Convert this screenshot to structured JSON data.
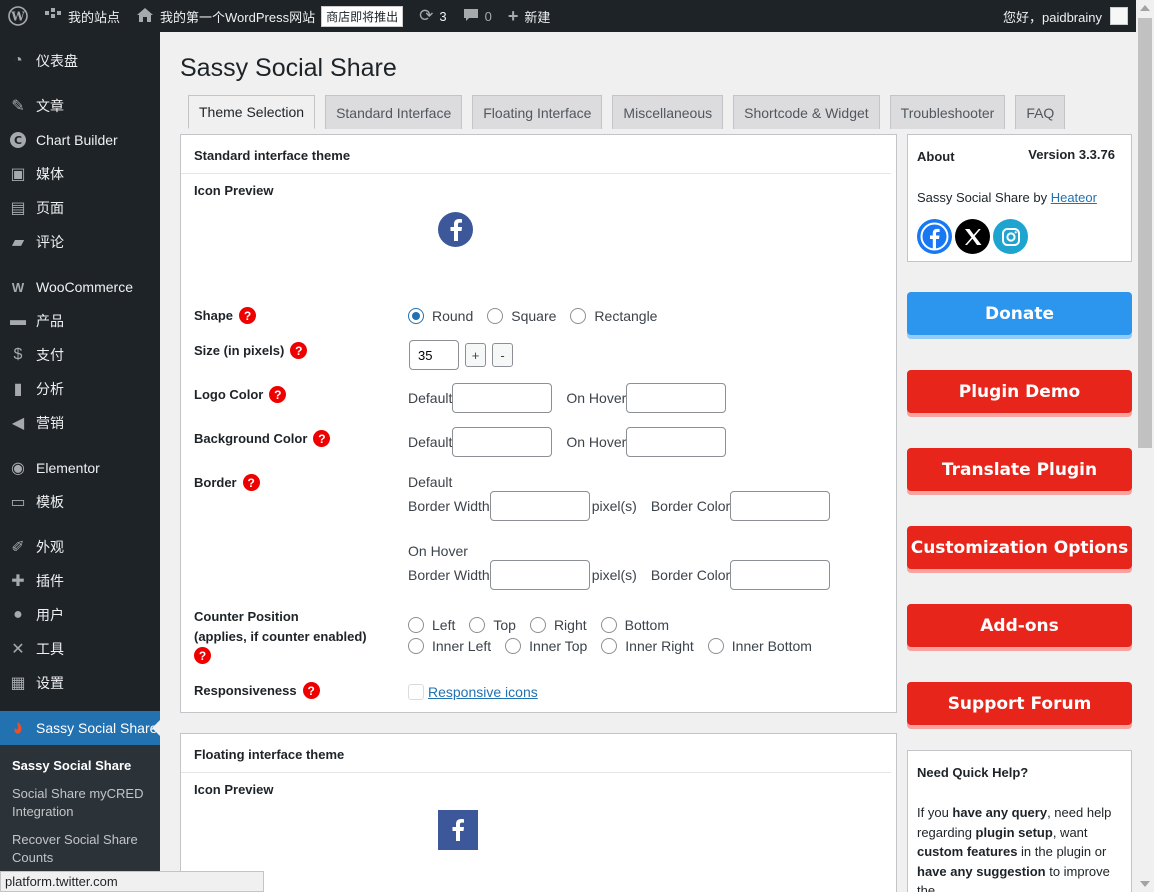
{
  "adminbar": {
    "site_name": "我的站点",
    "site_title": "我的第一个WordPress网站",
    "shop_badge": "商店即将推出",
    "updates_count": "3",
    "comments_count": "0",
    "new_label": "新建",
    "greeting": "您好，paidbrainy"
  },
  "sidebar": {
    "items": [
      {
        "label": "仪表盘",
        "icon": "dashboard-icon"
      },
      {
        "label": "文章",
        "icon": "pin-icon"
      },
      {
        "label": "Chart Builder",
        "icon": "chart-builder-icon"
      },
      {
        "label": "媒体",
        "icon": "media-icon"
      },
      {
        "label": "页面",
        "icon": "page-icon"
      },
      {
        "label": "评论",
        "icon": "comment-icon"
      },
      {
        "label": "WooCommerce",
        "icon": "woocommerce-icon"
      },
      {
        "label": "产品",
        "icon": "product-icon"
      },
      {
        "label": "支付",
        "icon": "payment-icon"
      },
      {
        "label": "分析",
        "icon": "analytics-icon"
      },
      {
        "label": "营销",
        "icon": "marketing-icon"
      },
      {
        "label": "Elementor",
        "icon": "elementor-icon"
      },
      {
        "label": "模板",
        "icon": "template-icon"
      },
      {
        "label": "外观",
        "icon": "appearance-icon"
      },
      {
        "label": "插件",
        "icon": "plugin-icon"
      },
      {
        "label": "用户",
        "icon": "user-icon"
      },
      {
        "label": "工具",
        "icon": "tools-icon"
      },
      {
        "label": "设置",
        "icon": "settings-icon"
      },
      {
        "label": "Sassy Social Share",
        "icon": "sassy-icon"
      }
    ],
    "submenu": [
      "Sassy Social Share",
      "Social Share myCRED Integration",
      "Recover Social Share Counts"
    ]
  },
  "statusbar": "platform.twitter.com",
  "page_title": "Sassy Social Share",
  "tabs": [
    "Theme Selection",
    "Standard Interface",
    "Floating Interface",
    "Miscellaneous",
    "Shortcode & Widget",
    "Troubleshooter",
    "FAQ"
  ],
  "standard_panel": {
    "header": "Standard interface theme",
    "icon_preview": "Icon Preview",
    "shape_label": "Shape",
    "shape_options": [
      "Round",
      "Square",
      "Rectangle"
    ],
    "size_label": "Size (in pixels)",
    "size_value": "35",
    "plus": "+",
    "minus": "-",
    "logo_color_label": "Logo Color",
    "bg_color_label": "Background Color",
    "default_label": "Default",
    "on_hover_label": "On Hover",
    "border_label": "Border",
    "border_default": "Default",
    "border_on_hover": "On Hover",
    "border_width": "Border Width",
    "pixels": "pixel(s)",
    "border_color": "Border Color",
    "counter_label_1": "Counter Position",
    "counter_label_2": "(applies, if counter enabled)",
    "counter_options_row1": [
      "Left",
      "Top",
      "Right",
      "Bottom"
    ],
    "counter_options_row2": [
      "Inner Left",
      "Inner Top",
      "Inner Right",
      "Inner Bottom"
    ],
    "responsiveness_label": "Responsiveness",
    "responsive_link": "Responsive icons"
  },
  "floating_panel": {
    "header": "Floating interface theme",
    "icon_preview": "Icon Preview"
  },
  "about": {
    "title": "About",
    "version": "Version 3.3.76",
    "credit_prefix": "Sassy Social Share by",
    "credit_link": "Heateor"
  },
  "side_buttons": [
    "Donate",
    "Plugin Demo",
    "Translate Plugin",
    "Customization Options",
    "Add-ons",
    "Support Forum"
  ],
  "colors": {
    "donate": "#2c95ee",
    "red_buttons": "#e8251b",
    "facebook": "#3c589a"
  },
  "help_box": {
    "title": "Need Quick Help?",
    "text_parts": [
      "If you ",
      "have any query",
      ", need help regarding ",
      "plugin setup",
      ", want ",
      "custom features",
      " in the plugin or ",
      "have any suggestion",
      " to improve the"
    ]
  },
  "help_icon_glyph": "?"
}
